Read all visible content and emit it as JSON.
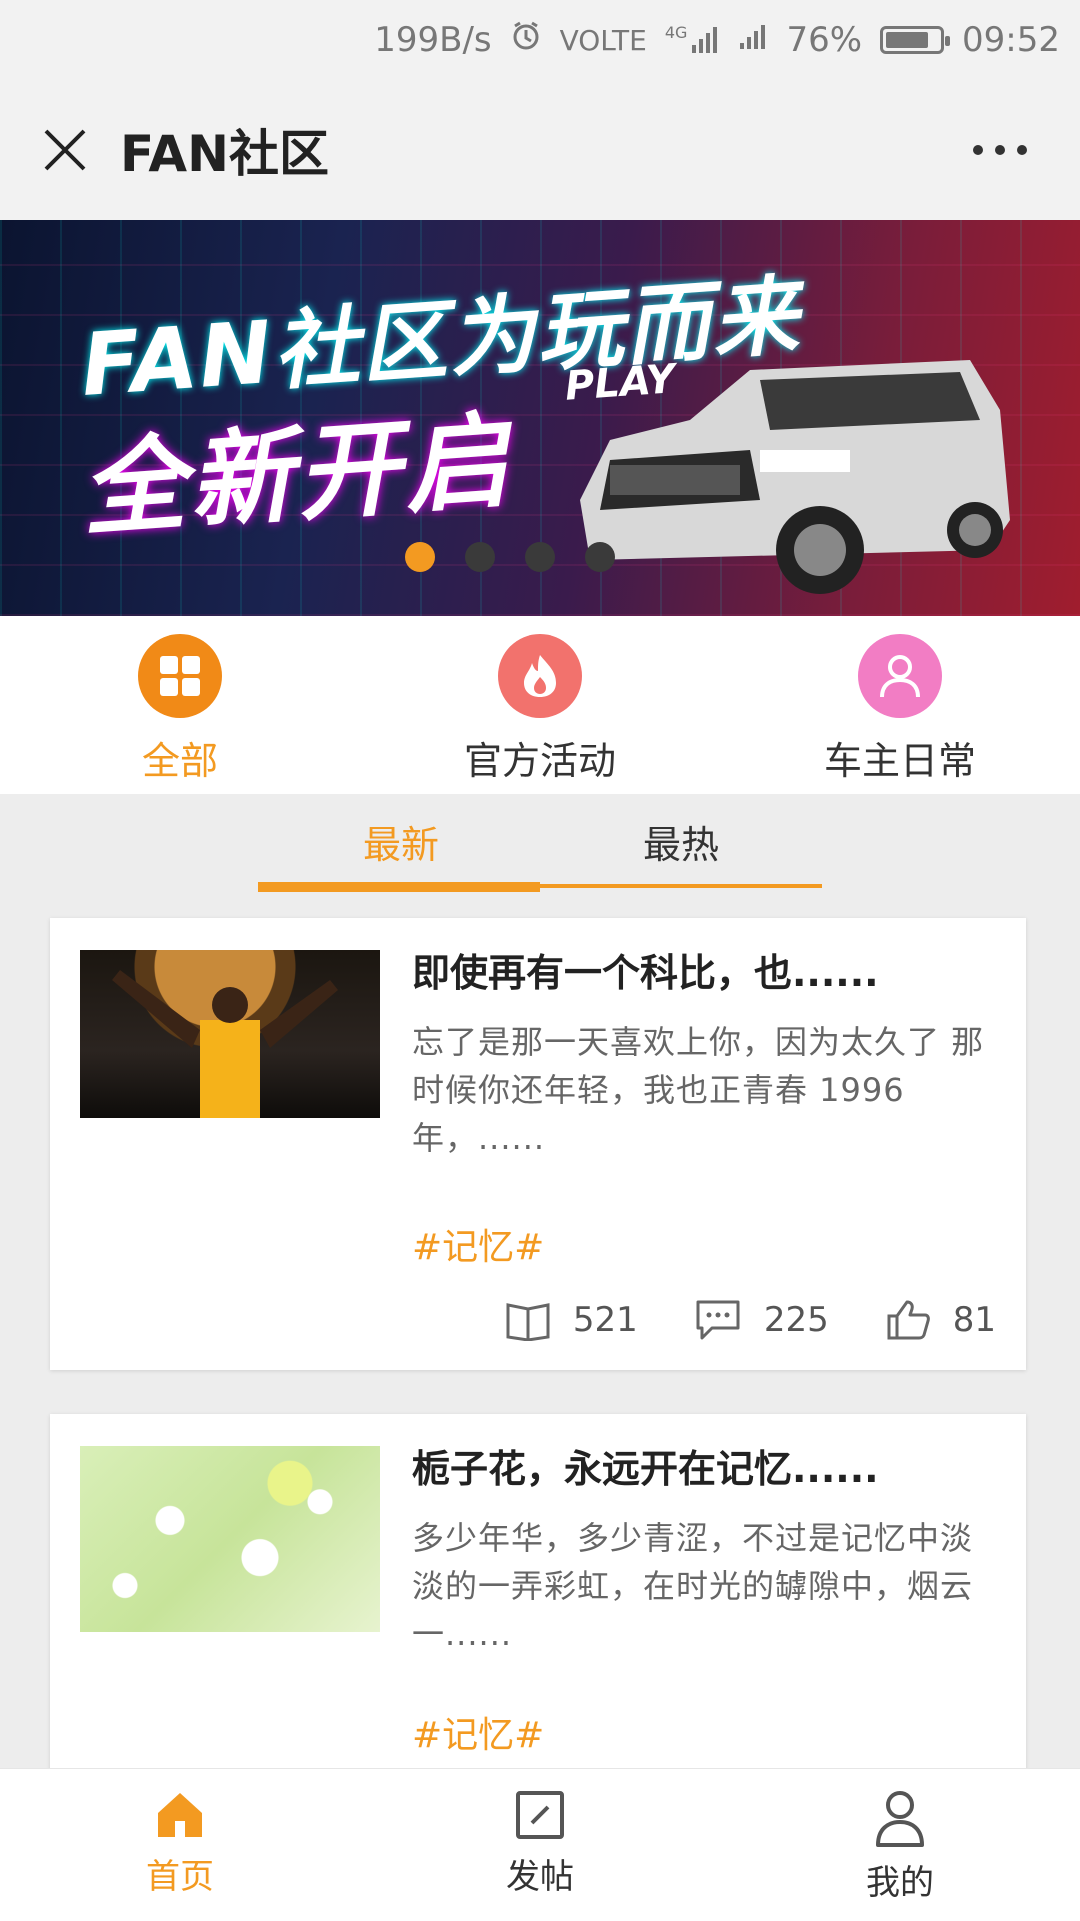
{
  "status_bar": {
    "speed": "199B/s",
    "network": "VOLTE",
    "signal_label": "4G",
    "battery": "76%",
    "time": "09:52",
    "icons": [
      "alarm-icon",
      "signal-icon",
      "battery-icon"
    ]
  },
  "header": {
    "title": "FAN社区",
    "icons": [
      "close-icon",
      "more-icon"
    ]
  },
  "banner": {
    "line1": "FAN社区为玩而来",
    "line2": "全新开启",
    "play": "PLAY",
    "slides": 4,
    "active_slide": 1
  },
  "categories": [
    {
      "label": "全部",
      "icon": "grid-icon",
      "color": "#f18a17",
      "active": true
    },
    {
      "label": "官方活动",
      "icon": "fire-icon",
      "color": "#f2726d",
      "active": false
    },
    {
      "label": "车主日常",
      "icon": "person-icon",
      "color": "#f27dc4",
      "active": false
    }
  ],
  "tabs": [
    {
      "label": "最新",
      "active": true
    },
    {
      "label": "最热",
      "active": false
    }
  ],
  "posts": [
    {
      "title": "即使再有一个科比，也......",
      "summary": "忘了是那一天喜欢上你，因为太久了 那时候你还年轻，我也正青春 1996年，......",
      "tag": "#记忆#",
      "views": "521",
      "comments": "225",
      "likes": "81"
    },
    {
      "title": "栀子花，永远开在记忆......",
      "summary": "多少年华，多少青涩，不过是记忆中淡淡的一弄彩虹，在时光的罅隙中，烟云一......",
      "tag": "#记忆#"
    }
  ],
  "bottom_nav": [
    {
      "label": "首页",
      "icon": "home-icon",
      "active": true
    },
    {
      "label": "发帖",
      "icon": "edit-icon",
      "active": false
    },
    {
      "label": "我的",
      "icon": "user-icon",
      "active": false
    }
  ],
  "colors": {
    "accent": "#f39a21",
    "background": "#ededed"
  }
}
